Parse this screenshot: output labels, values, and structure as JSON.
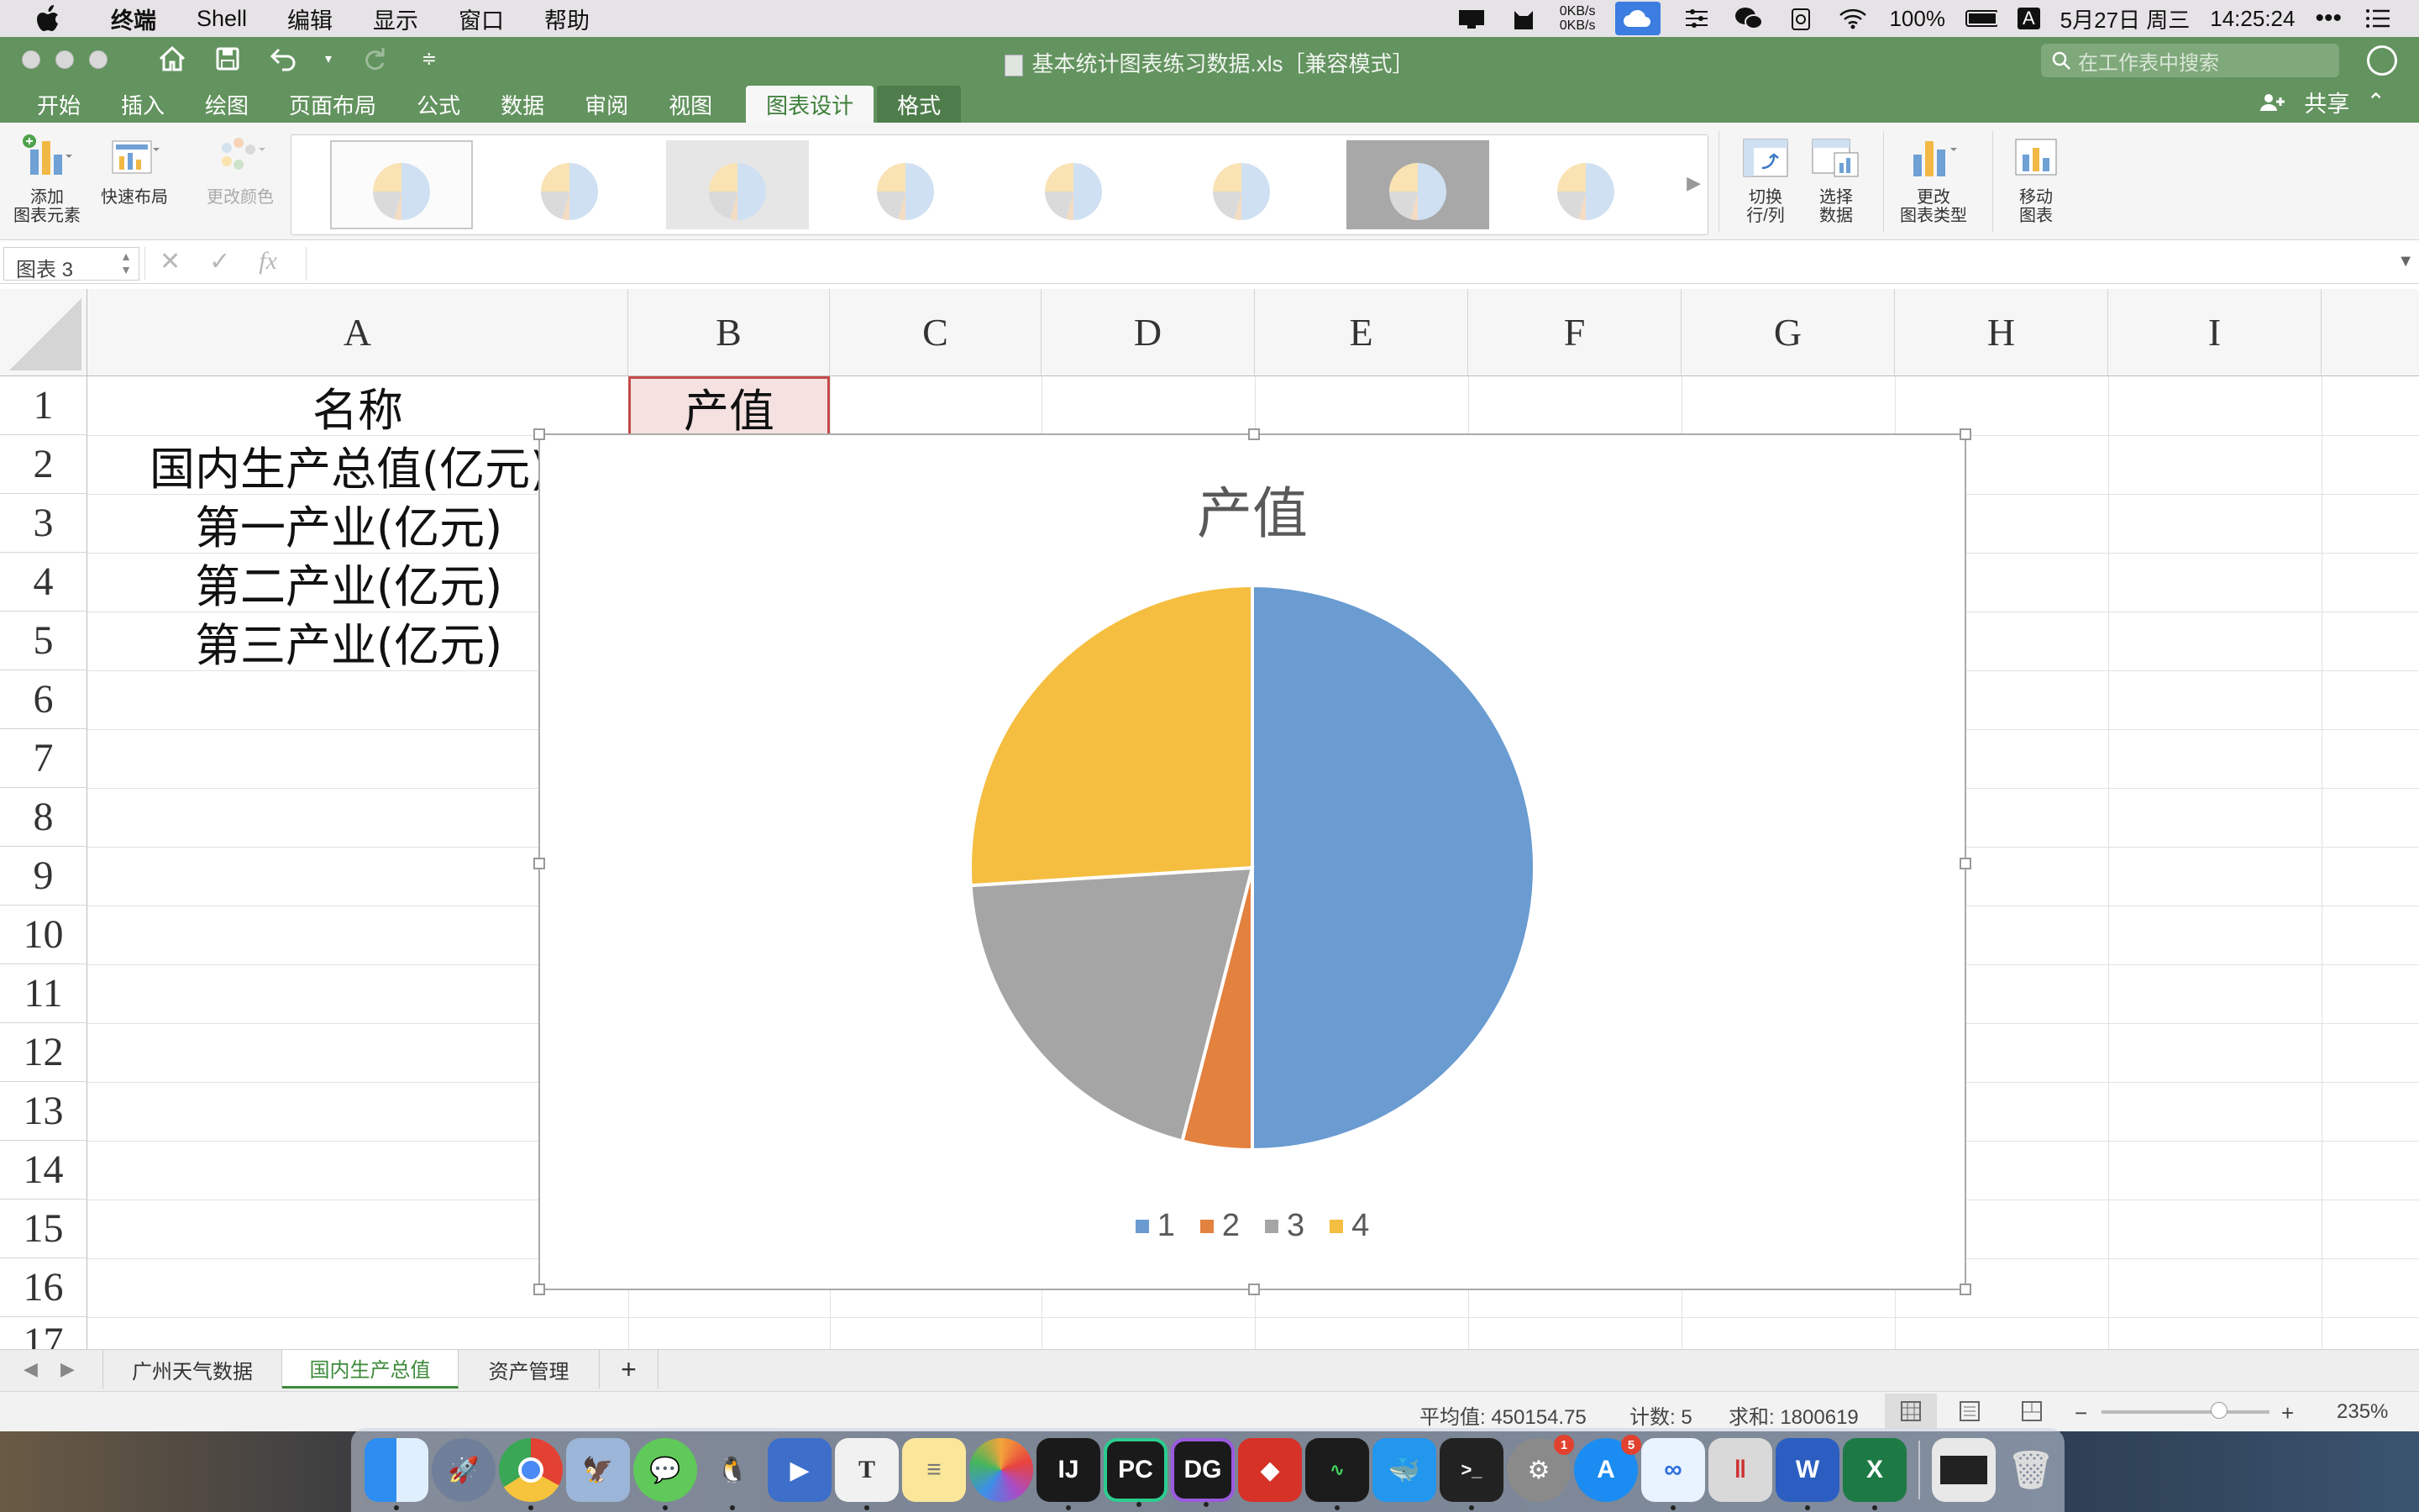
{
  "menubar": {
    "app": "终端",
    "items": [
      "Shell",
      "编辑",
      "显示",
      "窗口",
      "帮助"
    ],
    "net_up": "0KB/s",
    "net_down": "0KB/s",
    "battery": "100%",
    "input_method": "A",
    "date": "5月27日 周三",
    "time": "14:25:24"
  },
  "excel": {
    "doc_title": "基本统计图表练习数据.xls［兼容模式］",
    "search_placeholder": "在工作表中搜索",
    "tabs": [
      "开始",
      "插入",
      "绘图",
      "页面布局",
      "公式",
      "数据",
      "审阅",
      "视图"
    ],
    "active_tab": "图表设计",
    "format_tab": "格式",
    "share": "共享",
    "ribbon": {
      "add_element_1": "添加",
      "add_element_2": "图表元素",
      "quick_layout": "快速布局",
      "change_color": "更改颜色",
      "switch_1": "切换",
      "switch_2": "行/列",
      "select_1": "选择",
      "select_2": "数据",
      "change_type_1": "更改",
      "change_type_2": "图表类型",
      "move_1": "移动",
      "move_2": "图表"
    },
    "name_box": "图表 3",
    "columns": [
      "A",
      "B",
      "C",
      "D",
      "E",
      "F",
      "G",
      "H",
      "I"
    ],
    "rows": [
      "1",
      "2",
      "3",
      "4",
      "5",
      "6",
      "7",
      "8",
      "9",
      "10",
      "11",
      "12",
      "13",
      "14",
      "15",
      "16",
      "17"
    ],
    "cells": {
      "A1": "名称",
      "B1": "产值",
      "A2": "国内生产总值(亿元)",
      "A3": "第一产业(亿元)",
      "A4": "第二产业(亿元)",
      "A5": "第三产业(亿元)"
    },
    "sheets": [
      "广州天气数据",
      "国内生产总值",
      "资产管理"
    ],
    "active_sheet": "国内生产总值",
    "status": {
      "average": "平均值: 450154.75",
      "count": "计数: 5",
      "sum": "求和: 1800619",
      "zoom": "235%"
    }
  },
  "chart_data": {
    "type": "pie",
    "title": "产值",
    "categories": [
      "1",
      "2",
      "3",
      "4"
    ],
    "values": [
      50,
      4,
      20,
      26
    ],
    "colors": [
      "#6a9bd1",
      "#e3813f",
      "#a5a5a5",
      "#f5be40"
    ],
    "legend": "bottom"
  },
  "dock": [
    "Finder",
    "Launchpad",
    "Chrome",
    "Preview",
    "WeChat",
    "QQ",
    "Keynote",
    "Typora",
    "Notes",
    "Photos",
    "IntelliJ IDEA",
    "PyCharm",
    "DataGrip",
    "Redis",
    "Activity Monitor",
    "Docker",
    "Terminal",
    "System Preferences",
    "App Store",
    "Baidu Netdisk",
    "Parallels",
    "Word",
    "Excel",
    "Screen",
    "Trash"
  ]
}
